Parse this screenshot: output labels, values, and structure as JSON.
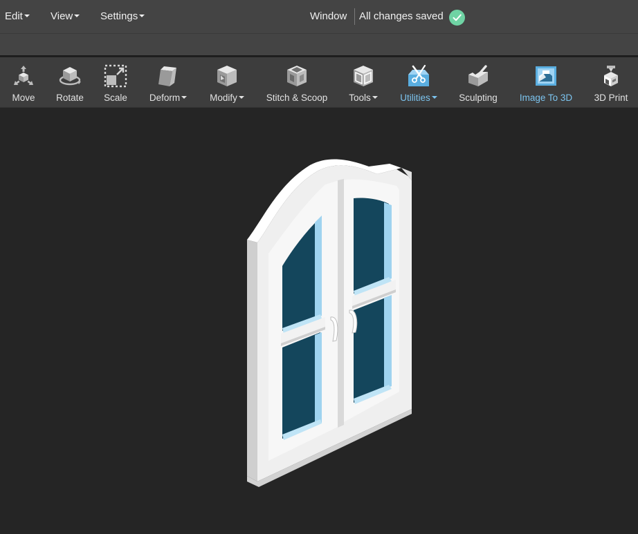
{
  "menu": {
    "edit": "Edit",
    "view": "View",
    "settings": "Settings"
  },
  "status": {
    "window_label": "Window",
    "saved_text": "All changes saved",
    "saved_icon": "check-circle-icon",
    "saved_color": "#6fd3a4"
  },
  "toolbar": {
    "move": "Move",
    "rotate": "Rotate",
    "scale": "Scale",
    "deform": "Deform",
    "modify": "Modify",
    "stitch": "Stitch & Scoop",
    "tools": "Tools",
    "utilities": "Utilities",
    "sculpting": "Sculpting",
    "image_to_3d": "Image To 3D",
    "print_3d": "3D Print",
    "accent_color": "#7cc4ef"
  },
  "viewport": {
    "background": "#252525",
    "model": "window-model"
  }
}
